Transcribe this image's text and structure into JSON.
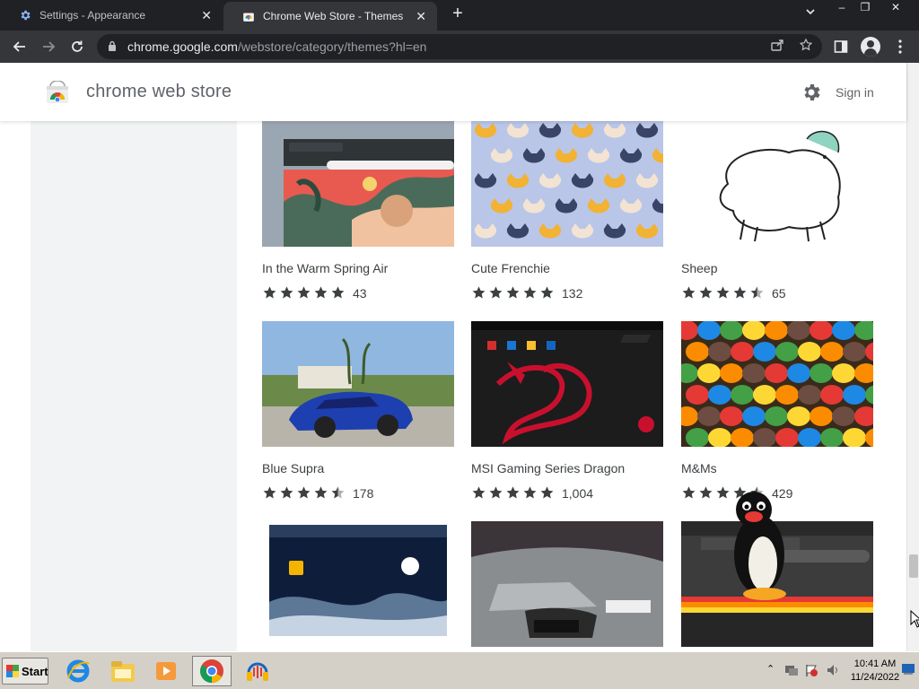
{
  "browser": {
    "tabs": [
      {
        "title": "Settings - Appearance",
        "active": false,
        "icon": "gear-icon"
      },
      {
        "title": "Chrome Web Store - Themes",
        "active": true,
        "icon": "chrome-web-store-icon"
      }
    ],
    "new_tab_symbol": "+",
    "close_symbol": "✕",
    "url_domain": "chrome.google.com",
    "url_path": "/webstore/category/themes?hl=en",
    "window_controls": [
      "–",
      "❐",
      "✕"
    ]
  },
  "store": {
    "title": "chrome web store",
    "sign_in": "Sign in"
  },
  "themes": [
    {
      "name": "In the Warm Spring Air",
      "stars": 5,
      "count": "43"
    },
    {
      "name": "Cute Frenchie",
      "stars": 5,
      "count": "132"
    },
    {
      "name": "Sheep",
      "stars": 4.5,
      "count": "65"
    },
    {
      "name": "Blue Supra",
      "stars": 4.5,
      "count": "178"
    },
    {
      "name": "MSI Gaming Series Dragon",
      "stars": 5,
      "count": "1,004"
    },
    {
      "name": "M&Ms",
      "stars": 4.5,
      "count": "429"
    },
    {
      "name": "",
      "stars": 0,
      "count": ""
    },
    {
      "name": "",
      "stars": 0,
      "count": ""
    },
    {
      "name": "",
      "stars": 0,
      "count": ""
    }
  ],
  "taskbar": {
    "start_label": "Start",
    "time": "10:41 AM",
    "date": "11/24/2022"
  },
  "colors": {
    "tab_bar": "#202124",
    "toolbar": "#35363a",
    "sidebar": "#f1f3f4",
    "star": "#3c4043",
    "taskbar": "#d4d0c8"
  }
}
